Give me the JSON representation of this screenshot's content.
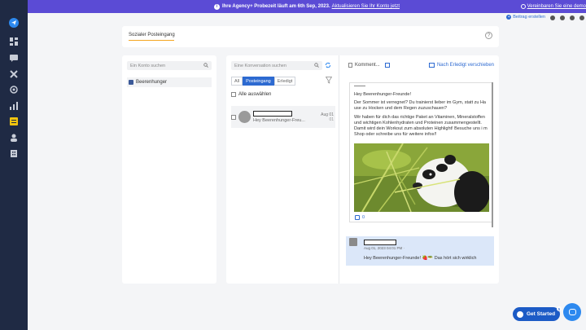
{
  "banner": {
    "prefix": "Ihre Agency+ Probezeit läuft am 6th Sep, 2023.",
    "link": "Aktualisieren Sie Ihr Konto jetzt",
    "right_link": "Vereinbaren Sie eine demo"
  },
  "topbar": {
    "create_post": "Beitrag erstellen"
  },
  "page": {
    "tab": "Sozialer Posteingang",
    "help": "?"
  },
  "accounts": {
    "search_placeholder": "Ein Konto suchen",
    "items": [
      "Beerenhunger"
    ]
  },
  "conversations": {
    "search_placeholder": "Eine Konversation suchen",
    "tabs": [
      "All",
      "Posteingang",
      "Erledigt"
    ],
    "active_tab": "Posteingang",
    "select_all": "Alle auswählen",
    "items": [
      {
        "snippet": "Hey Beerenhunger-Freu...",
        "date": "Aug 01",
        "count": "01"
      }
    ]
  },
  "detail": {
    "header": "Komment...",
    "move_done": "Nach Erledigt verschieben",
    "post": {
      "greeting": "Hey Beerenhunger-Freunde!",
      "para1": "Der Sommer ist verregnet? Du trainierst lieber im Gym, statt zu Ha use zu Hocken und dem Regen zuzuschauen?",
      "para2": "Wir haben für dich das richtige Paket an Vitaminen, Mineralstoffen und wichtigen Kohlenhydraten und Proteinen zusammengestellt. Damit wird dein Workout zum absoluten Highlight! Besuche uns i m Shop oder schreibe uns für weitere infos!!",
      "likes": "0"
    },
    "reply": {
      "meta": "Aug 01, 2023 04:01 PM ·",
      "message": "Hey Beerenhunger-Freunde! 🍓🥗 Das hört sich wirklich"
    }
  },
  "widgets": {
    "get_started": "Get Started",
    "badge": "5"
  },
  "colors": {
    "sidebar": "#1f2a44",
    "banner": "#5b4bd5",
    "accent": "#2d6ad1",
    "tab_underline": "#f5a623"
  }
}
